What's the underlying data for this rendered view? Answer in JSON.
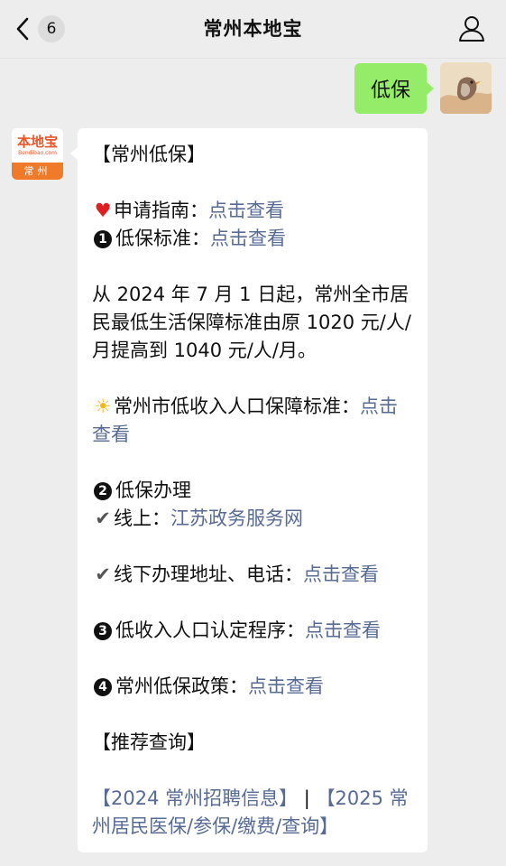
{
  "header": {
    "title": "常州本地宝",
    "unread_count": "6"
  },
  "outgoing": {
    "text": "低保"
  },
  "bot": {
    "avatar_top": "本地宝",
    "avatar_sub": "Bendibao.com",
    "avatar_city": "常州"
  },
  "message": {
    "heading": "【常州低保】",
    "guide_label": "申请指南：",
    "guide_link": "点击查看",
    "item1_num": "1",
    "item1_label": "低保标准：",
    "item1_link": "点击查看",
    "para1": "从 2024 年 7 月 1 日起，常州全市居民最低生活保障标准由原 1020 元/人/月提高到 1040 元/人/月。",
    "low_income_label": "常州市低收入人口保障标准：",
    "low_income_link": "点击查看",
    "item2_num": "2",
    "item2_label": "低保办理",
    "online_label": "线上：",
    "online_link": "江苏政务服务网",
    "offline_label": "线下办理地址、电话：",
    "offline_link": "点击查看",
    "item3_num": "3",
    "item3_label": "低收入人口认定程序：",
    "item3_link": "点击查看",
    "item4_num": "4",
    "item4_label": "常州低保政策：",
    "item4_link": "点击查看",
    "recommend_heading": "【推荐查询】",
    "rec_link1": "【2024 常州招聘信息】",
    "rec_sep": " | ",
    "rec_link2": "【2025 常州居民医保/参保/缴费/查询】"
  },
  "icons": {
    "heart": "heart-icon",
    "sun": "sun-icon",
    "check": "check-icon",
    "back": "chevron-left-icon",
    "user": "user-icon"
  },
  "colors": {
    "link": "#576b95",
    "outgoing_bubble": "#95ec69",
    "background": "#ededed"
  }
}
